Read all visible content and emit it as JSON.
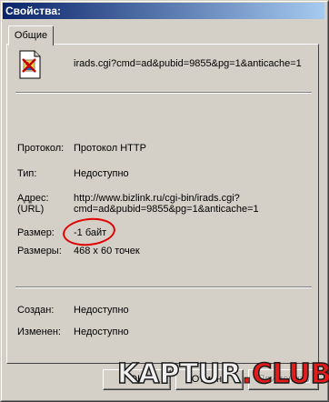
{
  "window": {
    "title": "Свойства:"
  },
  "tabs": [
    {
      "label": "Общие",
      "active": true
    }
  ],
  "file": {
    "icon": "broken-image-file-icon",
    "name": "irads.cgi?cmd=ad&pubid=9855&pg=1&anticache=1"
  },
  "properties": {
    "protocol": {
      "label": "Протокол:",
      "value": "Протокол HTTP"
    },
    "type": {
      "label": "Тип:",
      "value": "Недоступно"
    },
    "address": {
      "label_line1": "Адрес:",
      "label_line2": "(URL)",
      "value_line1": "http://www.bizlink.ru/cgi-bin/irads.cgi?",
      "value_line2": "cmd=ad&pubid=9855&pg=1&anticache=1"
    },
    "size": {
      "label": "Размер:",
      "value": "-1 байт",
      "highlight_color": "#e00000"
    },
    "dimensions": {
      "label": "Размеры:",
      "value": "468 x 60 точек"
    },
    "created": {
      "label": "Создан:",
      "value": "Недоступно"
    },
    "modified": {
      "label": "Изменен:",
      "value": "Недоступно"
    }
  },
  "buttons": {
    "ok": "OK",
    "cancel": "Отмена",
    "apply": "Применить"
  },
  "watermark": {
    "part1": "KAPTUR",
    "part2": ".",
    "part3": "CLUB"
  },
  "colors": {
    "title_bar_start": "#0a246a",
    "title_bar_end": "#a6caf0",
    "window_bg": "#d4d0c8",
    "watermark_accent": "#e31b1b"
  }
}
